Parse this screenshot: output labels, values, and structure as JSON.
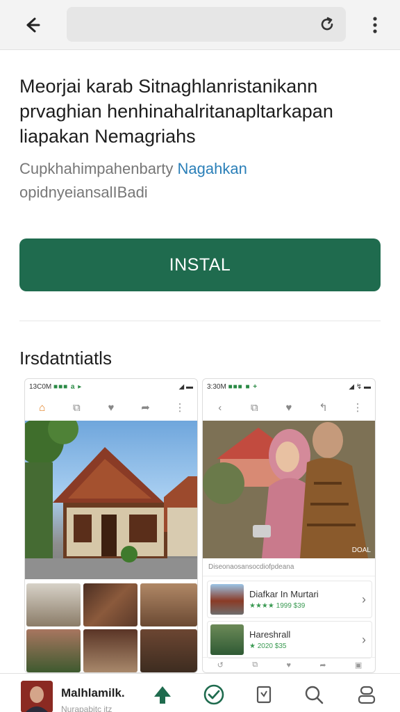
{
  "description": {
    "title_lines": [
      "Meorjai karab Sitnaghlanristanikann",
      "prvaghian henhinahalritanapltarkapan",
      "liapakan Nemagriahs"
    ],
    "sub_text": "Cupkhahimpahenbarty",
    "sub_link": "Nagahkan",
    "sub_line2": "opidnyeiansalIBadi"
  },
  "install_label": "INSTAL",
  "section_title": "Irsdatntiatls",
  "screenshot_left": {
    "status_time": "13C0M",
    "status_dots": "■■■ a ▸",
    "status_right": "◢ ▬"
  },
  "screenshot_right": {
    "status_time": "3:30M",
    "status_dots": "■■■ ■ +",
    "status_right": "◢ ↯ ▬",
    "photo_tag": "DOAL",
    "caption": "Diseonaosansocdiofpdeana",
    "rows": [
      {
        "title": "Diafkar In Murtari",
        "meta": "★★★★ 1999 $39"
      },
      {
        "title": "Hareshrall",
        "meta": "★ 2020 $35"
      }
    ]
  },
  "bottom_nav": {
    "name": "Malhlamilk.",
    "sub": "Nurapabitc itz"
  },
  "colors": {
    "accent": "#1f6b4e",
    "link": "#2a7fb8"
  }
}
